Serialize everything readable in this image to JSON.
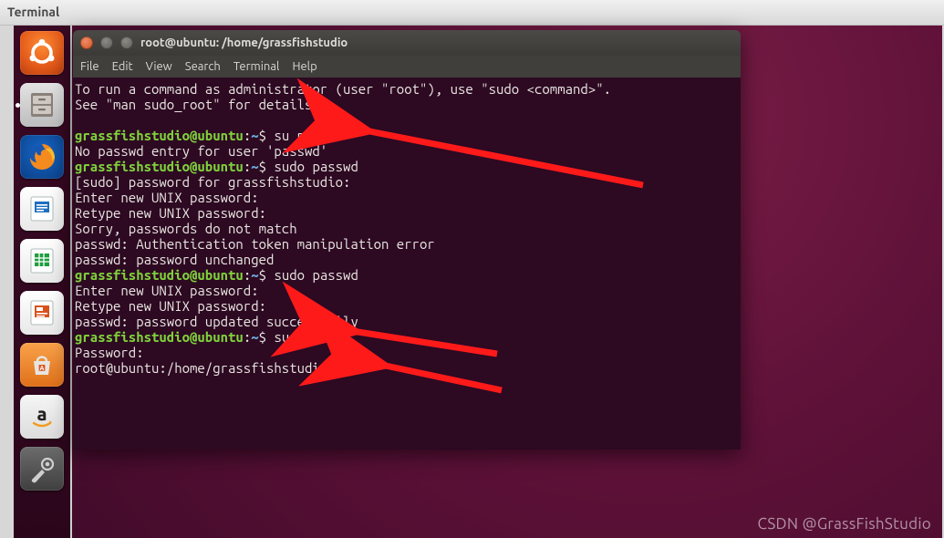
{
  "outer": {
    "title": "Terminal"
  },
  "launcher": {
    "items": [
      {
        "name": "dash",
        "tip": "Ubuntu Dash"
      },
      {
        "name": "files",
        "tip": "Files"
      },
      {
        "name": "firefox",
        "tip": "Firefox"
      },
      {
        "name": "writer",
        "tip": "LibreOffice Writer"
      },
      {
        "name": "calc",
        "tip": "LibreOffice Calc"
      },
      {
        "name": "impress",
        "tip": "LibreOffice Impress"
      },
      {
        "name": "software",
        "tip": "Ubuntu Software"
      },
      {
        "name": "amazon",
        "tip": "Amazon"
      },
      {
        "name": "settings",
        "tip": "System Settings"
      }
    ]
  },
  "terminal": {
    "title": "root@ubuntu: /home/grassfishstudio",
    "menus": [
      "File",
      "Edit",
      "View",
      "Search",
      "Terminal",
      "Help"
    ],
    "prompt": {
      "user_host": "grassfishstudio@ubuntu",
      "sep": ":",
      "cwd": "~",
      "sigil": "$ "
    },
    "root_prompt": "root@ubuntu:/home/grassfishstudio# ",
    "lines": {
      "l0": "To run a command as administrator (user \"root\"), use \"sudo <command>\".",
      "l1": "See \"man sudo_root\" for details.",
      "blank": "",
      "c1": "su passwd",
      "l2": "No passwd entry for user 'passwd'",
      "c2": "sudo passwd",
      "l3": "[sudo] password for grassfishstudio: ",
      "l4": "Enter new UNIX password: ",
      "l5": "Retype new UNIX password: ",
      "l6": "Sorry, passwords do not match",
      "l7": "passwd: Authentication token manipulation error",
      "l8": "passwd: password unchanged",
      "c3": "sudo passwd",
      "l9": "Enter new UNIX password: ",
      "l10": "Retype new UNIX password: ",
      "l11": "passwd: password updated successfully",
      "c4": "su root",
      "l12": "Password: "
    }
  },
  "watermark": "CSDN @GrassFishStudio"
}
